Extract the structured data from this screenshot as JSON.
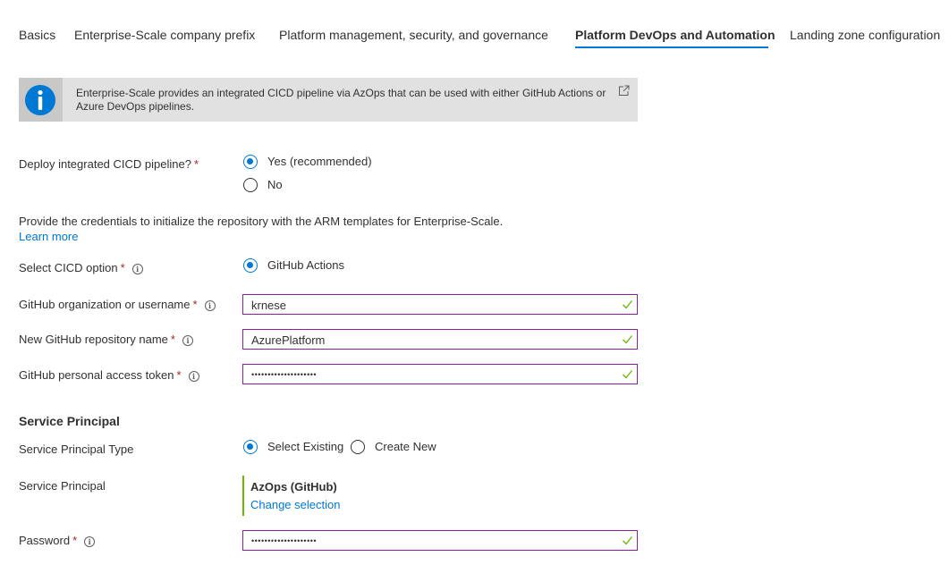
{
  "tabs": [
    {
      "label": "Basics"
    },
    {
      "label": "Enterprise-Scale company prefix"
    },
    {
      "label": "Platform management, security, and governance"
    },
    {
      "label": "Platform DevOps and Automation",
      "active": true
    },
    {
      "label": "Landing zone configuration"
    }
  ],
  "banner": {
    "text": "Enterprise-Scale provides an integrated CICD pipeline via AzOps that can be used with either GitHub Actions or Azure DevOps pipelines."
  },
  "deploy_pipeline": {
    "label": "Deploy integrated CICD pipeline?",
    "options": [
      "Yes (recommended)",
      "No"
    ],
    "selected": "Yes (recommended)"
  },
  "credentials": {
    "description": "Provide the credentials to initialize the repository with the ARM templates for Enterprise-Scale.",
    "learn_more": "Learn more"
  },
  "cicd_option": {
    "label": "Select CICD option",
    "options": [
      "GitHub Actions"
    ],
    "selected": "GitHub Actions"
  },
  "github_org": {
    "label": "GitHub organization or username",
    "value": "krnese"
  },
  "github_repo": {
    "label": "New GitHub repository name",
    "value": "AzurePlatform"
  },
  "github_token": {
    "label": "GitHub personal access token",
    "value": "••••••••••••••••••••"
  },
  "service_principal_section": {
    "heading": "Service Principal",
    "type_label": "Service Principal Type",
    "type_options": [
      "Select Existing",
      "Create New"
    ],
    "type_selected": "Select Existing",
    "sp_label": "Service Principal",
    "sp_name": "AzOps (GitHub)",
    "change_selection": "Change selection"
  },
  "password": {
    "label": "Password",
    "value": "••••••••••••••••••••"
  },
  "required_mark": "*",
  "colors": {
    "accent": "#0078d4",
    "valid_border": "#8c1d9e",
    "valid_check": "#6bb700",
    "required": "#a4262c"
  }
}
